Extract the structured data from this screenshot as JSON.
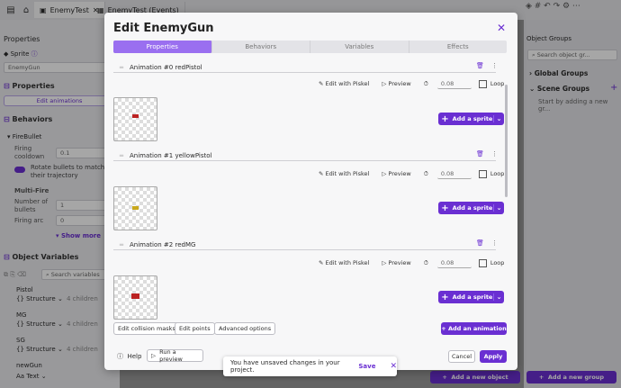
{
  "tabs": [
    {
      "label": "EnemyTest"
    },
    {
      "label": "EnemyTest (Events)"
    }
  ],
  "left": {
    "properties_title": "Properties",
    "sprite_label": "Sprite",
    "object_name_placeholder": "EnemyGun",
    "properties_section": "Properties",
    "edit_animations": "Edit animations",
    "behaviors_section": "Behaviors",
    "behavior_name": "FireBullet",
    "firing_cooldown_label": "Firing\ncooldown",
    "firing_cooldown_value": "0.1",
    "rotate_label": "Rotate bullets to match their trajectory",
    "multifire_label": "Multi-Fire",
    "num_bullets_label": "Number of\nbullets",
    "num_bullets_value": "1",
    "firing_arc_label": "Firing arc",
    "firing_arc_value": "0",
    "show_more": "Show more",
    "object_variables": "Object Variables",
    "search_variables": "Search variables",
    "variables": [
      {
        "name": "Pistol",
        "type": "Structure",
        "children": "4 children"
      },
      {
        "name": "MG",
        "type": "Structure",
        "children": "4 children"
      },
      {
        "name": "SG",
        "type": "Structure",
        "children": "4 children"
      },
      {
        "name": "newGun",
        "type": "Text",
        "children": ""
      }
    ]
  },
  "right": {
    "title": "Object Groups",
    "search_placeholder": "Search object gr...",
    "global_groups": "Global Groups",
    "scene_groups": "Scene Groups",
    "empty_text": "Start by adding a new gr...",
    "add_new_object": "Add a new object",
    "add_new_group": "Add a new group"
  },
  "dialog": {
    "title": "Edit EnemyGun",
    "tabs": [
      "Properties",
      "Behaviors",
      "Variables",
      "Effects"
    ],
    "animations": [
      {
        "index_label": "Animation #0",
        "name": "redPistol",
        "fps": "0.08",
        "loop": "Loop"
      },
      {
        "index_label": "Animation #1",
        "name": "yellowPistol",
        "fps": "0.08",
        "loop": "Loop"
      },
      {
        "index_label": "Animation #2",
        "name": "redMG",
        "fps": "0.08",
        "loop": "Loop"
      }
    ],
    "edit_with_piskel": "Edit with Piskel",
    "preview": "Preview",
    "add_sprite": "Add a sprite",
    "edit_collision_masks": "Edit collision masks",
    "edit_points": "Edit points",
    "advanced_options": "Advanced options",
    "add_animation": "Add an animation",
    "help": "Help",
    "run_preview": "Run a preview",
    "cancel": "Cancel",
    "apply": "Apply"
  },
  "toast": {
    "message": "You have unsaved changes in your project.",
    "save": "Save"
  },
  "colors": {
    "accent": "#6a2fd2",
    "accent_light": "#9a6ff0"
  }
}
